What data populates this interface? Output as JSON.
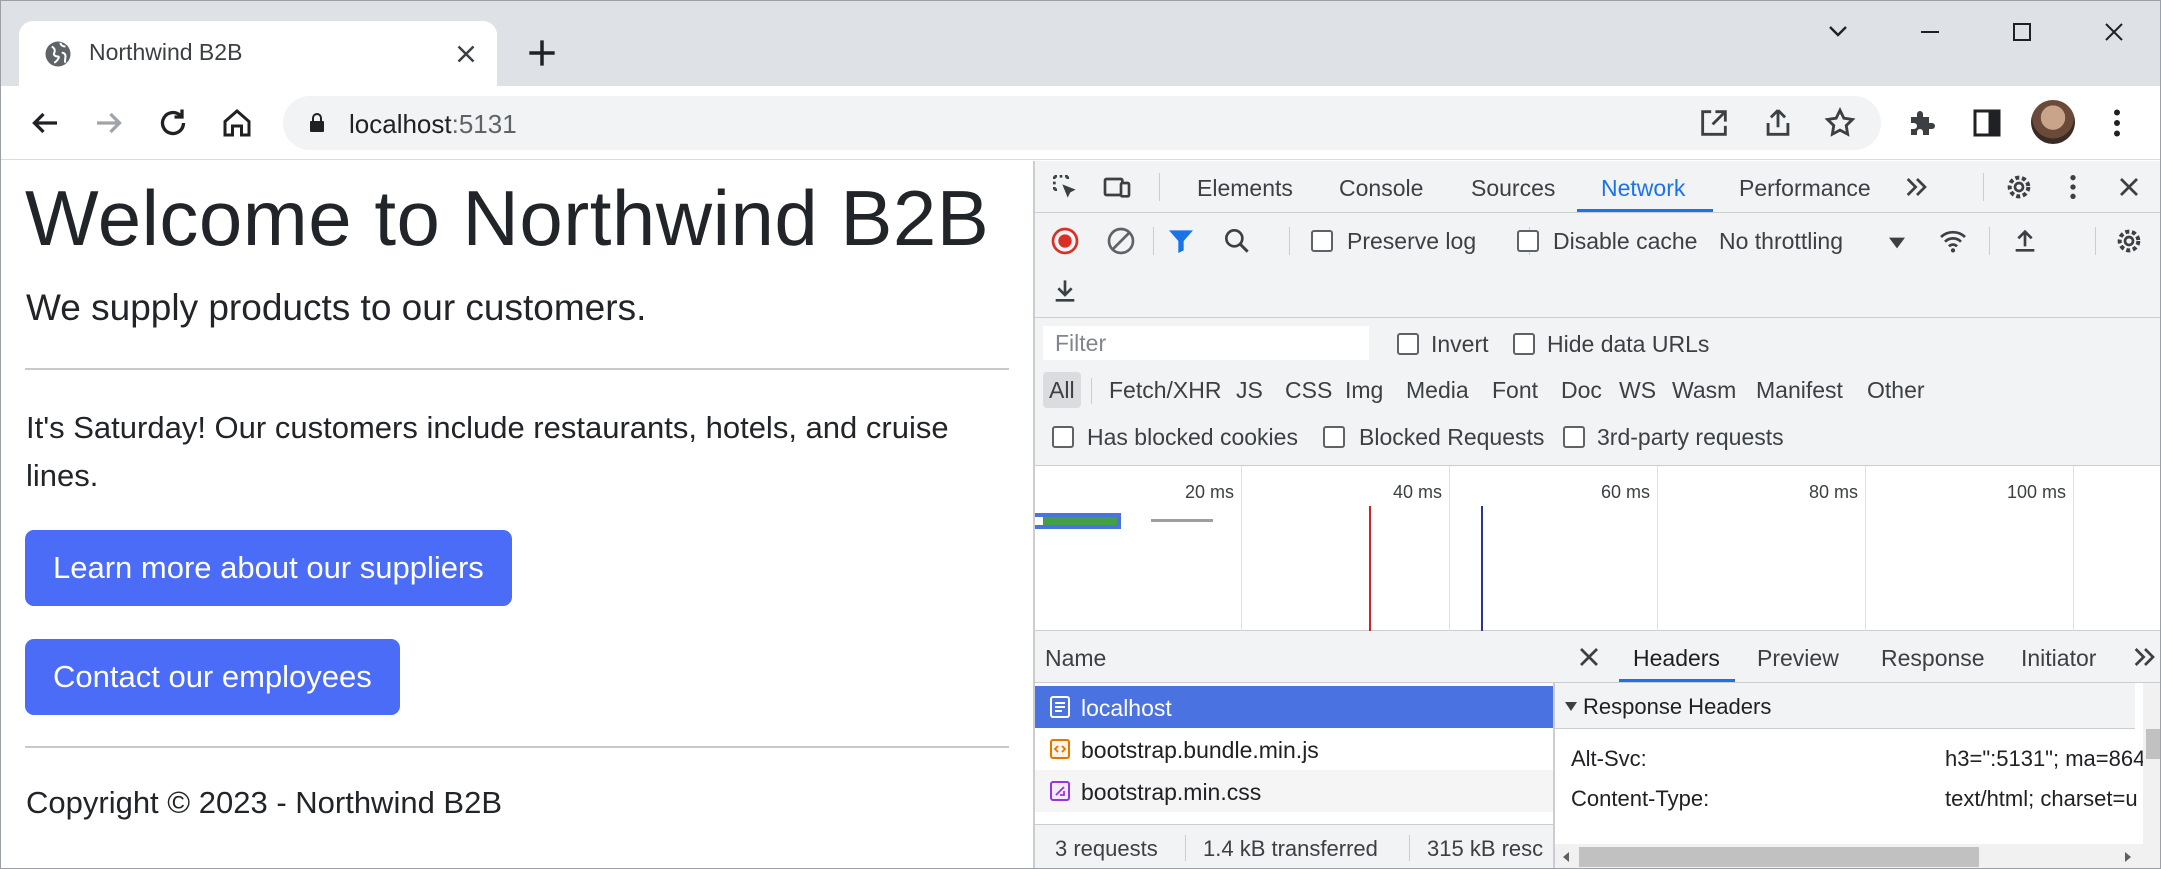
{
  "browser": {
    "tab_title": "Northwind B2B",
    "url_host": "localhost",
    "url_port": ":5131"
  },
  "page": {
    "heading": "Welcome to Northwind B2B",
    "lead": "We supply products to our customers.",
    "paragraph": "It's Saturday! Our customers include restaurants, hotels, and cruise lines.",
    "suppliers_button": "Learn more about our suppliers",
    "employees_button": "Contact our employees",
    "copyright": "Copyright © 2023 - Northwind B2B",
    "button_color": "#4a6cf7"
  },
  "devtools": {
    "tabs": [
      "Elements",
      "Console",
      "Sources",
      "Network",
      "Performance"
    ],
    "active_tab": "Network",
    "preserve_log": "Preserve log",
    "disable_cache": "Disable cache",
    "throttling": "No throttling",
    "filter_placeholder": "Filter",
    "invert": "Invert",
    "hide_data_urls": "Hide data URLs",
    "types": [
      "All",
      "Fetch/XHR",
      "JS",
      "CSS",
      "Img",
      "Media",
      "Font",
      "Doc",
      "WS",
      "Wasm",
      "Manifest",
      "Other"
    ],
    "active_type": "All",
    "has_blocked_cookies": "Has blocked cookies",
    "blocked_requests": "Blocked Requests",
    "third_party": "3rd-party requests",
    "timeline_ticks": [
      "20 ms",
      "40 ms",
      "60 ms",
      "80 ms",
      "100 ms"
    ],
    "name_column": "Name",
    "requests": [
      {
        "name": "localhost",
        "kind": "document",
        "selected": true
      },
      {
        "name": "bootstrap.bundle.min.js",
        "kind": "script",
        "selected": false
      },
      {
        "name": "bootstrap.min.css",
        "kind": "stylesheet",
        "selected": false
      }
    ],
    "status": {
      "requests": "3 requests",
      "transferred": "1.4 kB transferred",
      "resources": "315 kB resc"
    },
    "detail_tabs": [
      "Headers",
      "Preview",
      "Response",
      "Initiator"
    ],
    "active_detail_tab": "Headers",
    "section_title": "Response Headers",
    "headers": [
      {
        "name": "Alt-Svc:",
        "value": "h3=\":5131\"; ma=864"
      },
      {
        "name": "Content-Type:",
        "value": "text/html; charset=u"
      }
    ],
    "accent": "#1a73e8",
    "selected_row_color": "#4a72e0"
  }
}
